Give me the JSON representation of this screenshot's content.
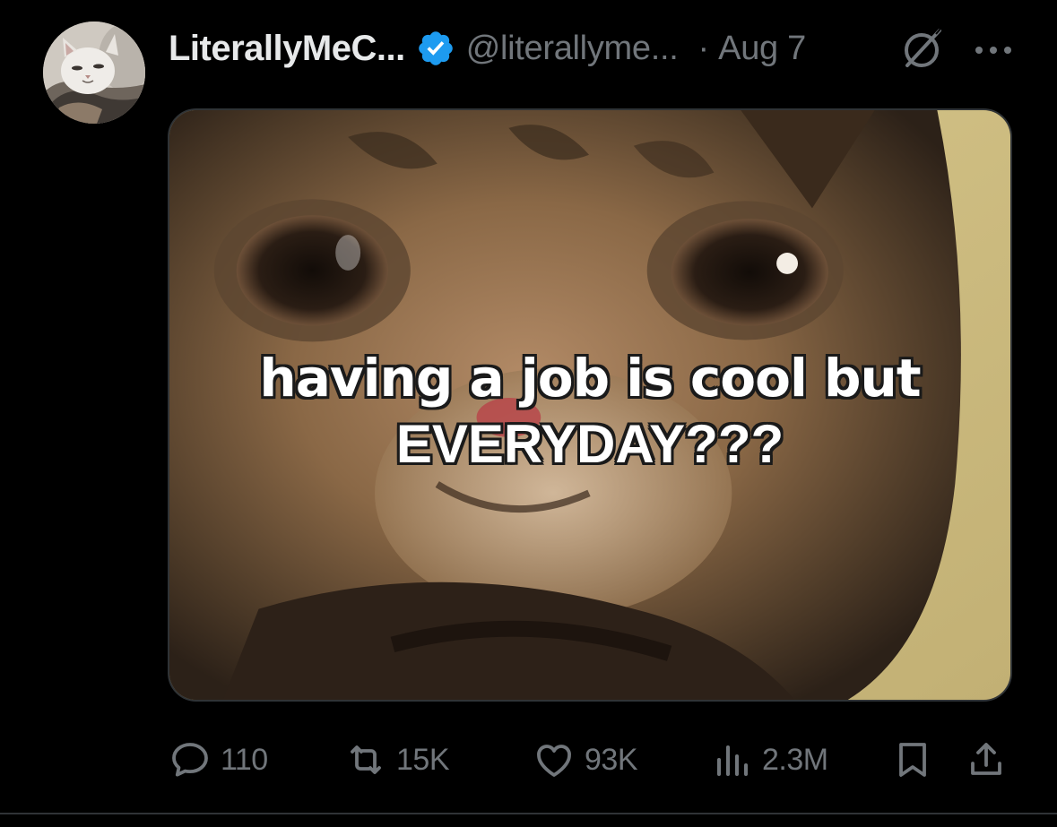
{
  "post": {
    "display_name": "LiterallyMeC...",
    "verified": true,
    "handle": "@literallyme...",
    "separator": "·",
    "timestamp": "Aug 7",
    "media": {
      "caption_line1": "having a job is cool but",
      "caption_line2": "EVERYDAY???"
    },
    "actions": {
      "reply_count": "110",
      "repost_count": "15K",
      "like_count": "93K",
      "view_count": "2.3M"
    }
  },
  "icons": {
    "verified": "verified-badge-icon",
    "grok": "grok-icon",
    "more": "more-icon",
    "reply": "reply-icon",
    "repost": "repost-icon",
    "like": "heart-icon",
    "views": "views-icon",
    "bookmark": "bookmark-icon",
    "share": "share-icon"
  },
  "colors": {
    "background": "#000000",
    "primary_text": "#e7e9ea",
    "secondary_text": "#71767b",
    "verified_blue": "#1d9bf0",
    "divider": "#2f3336"
  }
}
